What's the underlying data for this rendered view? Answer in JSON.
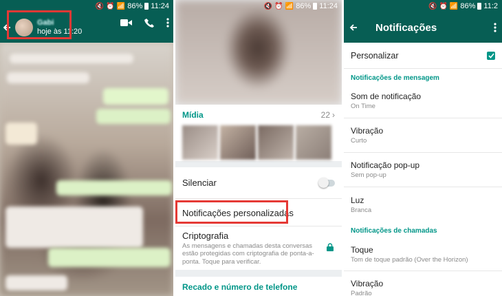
{
  "status": {
    "battery": "86%",
    "time_1": "11:24",
    "time_2": "11:24",
    "time_3": "11:2"
  },
  "chat": {
    "contact_name": "Gabi",
    "last_seen": "hoje às 11:20"
  },
  "contact_info": {
    "media_label": "Mídia",
    "media_count": "22",
    "mute_label": "Silenciar",
    "custom_notifications_label": "Notificações personalizadas",
    "encryption_label": "Criptografia",
    "encryption_desc": "As mensagens e chamadas desta conversas estão protegidas com criptografia de ponta-a-ponta. Toque para verificar.",
    "about_phone_label": "Recado e número de telefone"
  },
  "notifications": {
    "title": "Notificações",
    "customize_label": "Personalizar",
    "message_section": "Notificações de mensagem",
    "items": [
      {
        "label": "Som de notificação",
        "value": "On Time"
      },
      {
        "label": "Vibração",
        "value": "Curto"
      },
      {
        "label": "Notificação pop-up",
        "value": "Sem pop-up"
      },
      {
        "label": "Luz",
        "value": "Branca"
      }
    ],
    "call_section": "Notificações de chamadas",
    "call_items": [
      {
        "label": "Toque",
        "value": "Tom de toque padrão (Over the Horizon)"
      },
      {
        "label": "Vibração",
        "value": "Padrão"
      }
    ]
  },
  "colors": {
    "header": "#075e54",
    "accent": "#009688",
    "highlight": "#e53935"
  }
}
